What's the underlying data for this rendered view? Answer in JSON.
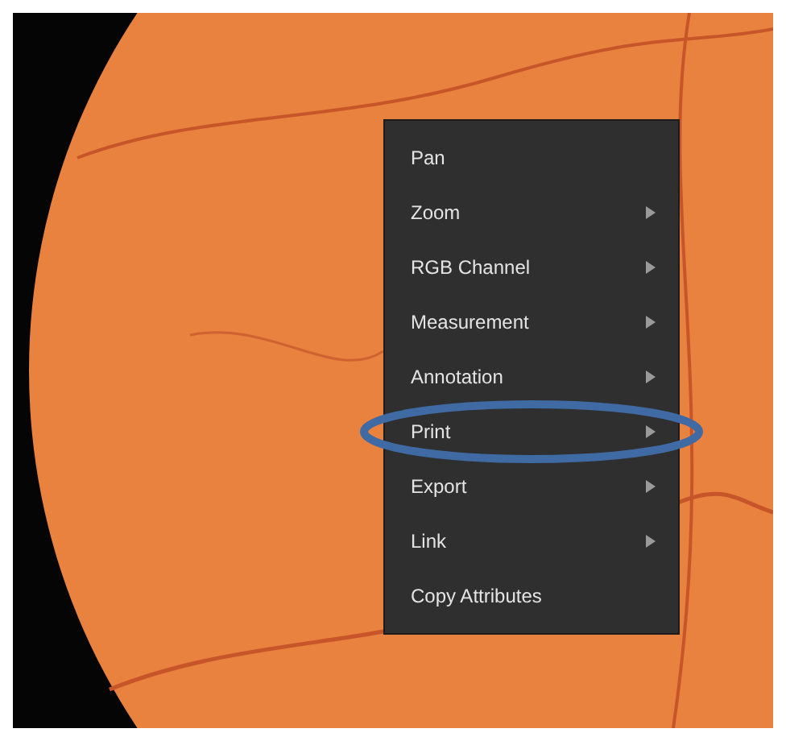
{
  "context_menu": {
    "items": [
      {
        "label": "Pan",
        "submenu": false,
        "circled": false
      },
      {
        "label": "Zoom",
        "submenu": true,
        "circled": false
      },
      {
        "label": "RGB Channel",
        "submenu": true,
        "circled": false
      },
      {
        "label": "Measurement",
        "submenu": true,
        "circled": false
      },
      {
        "label": "Annotation",
        "submenu": true,
        "circled": false
      },
      {
        "label": "Print",
        "submenu": true,
        "circled": true
      },
      {
        "label": "Export",
        "submenu": true,
        "circled": false
      },
      {
        "label": "Link",
        "submenu": true,
        "circled": false
      },
      {
        "label": "Copy Attributes",
        "submenu": false,
        "circled": false
      }
    ]
  }
}
